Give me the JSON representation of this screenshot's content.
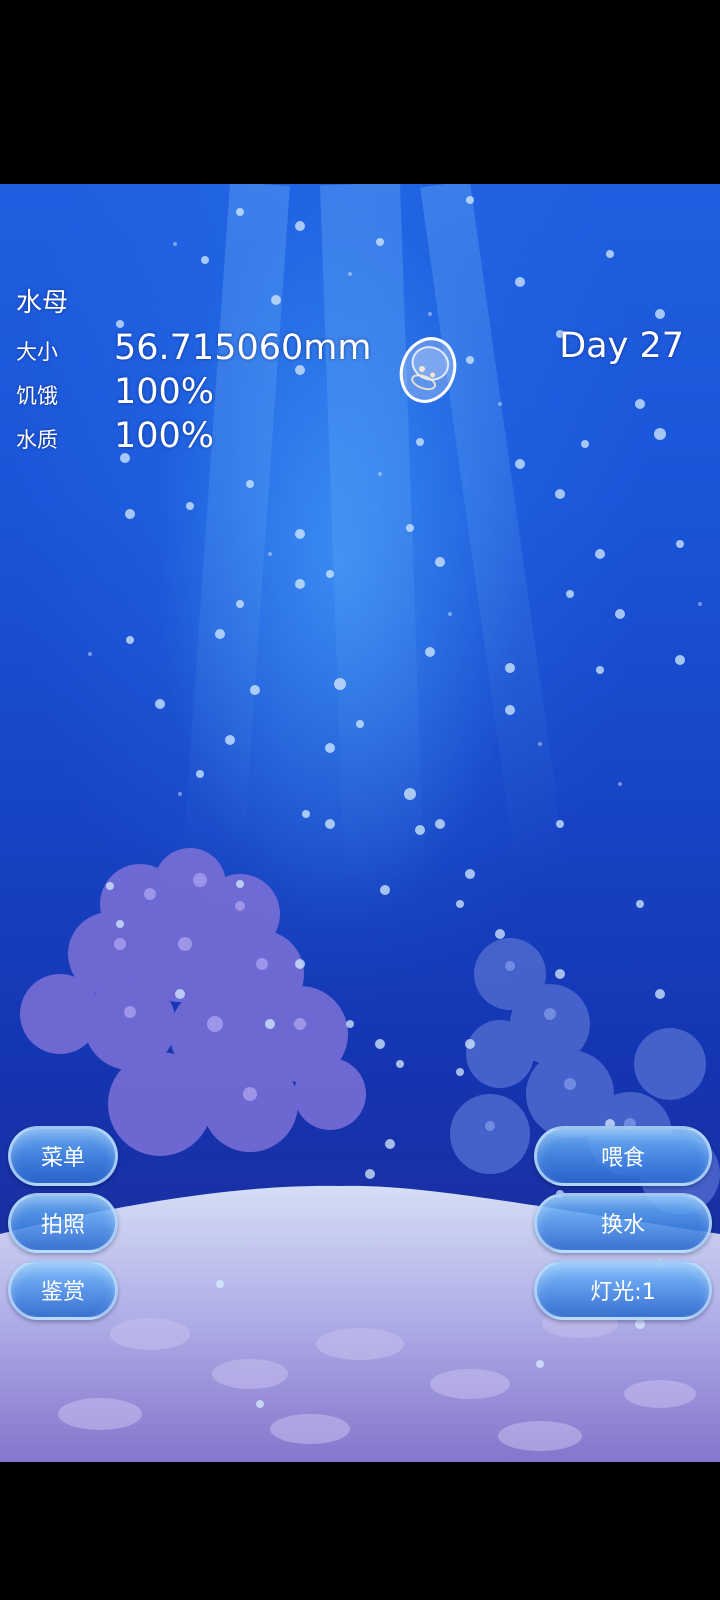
{
  "hud": {
    "title": "水母",
    "size_label": "大小",
    "size_value": "56.715060mm",
    "hunger_label": "饥饿",
    "hunger_value": "100%",
    "water_label": "水质",
    "water_value": "100%",
    "day": "Day 27"
  },
  "buttons_left": {
    "menu": "菜单",
    "photo": "拍照",
    "appreciate": "鉴赏"
  },
  "buttons_right": {
    "feed": "喂食",
    "change_water": "换水",
    "light": "灯光:1"
  },
  "colors": {
    "water_top": "#1f5fe0",
    "water_bottom": "#2a2f8e",
    "coral": "#8a7ee0",
    "sand": "#c8c8f0",
    "button": "#5a9ae8"
  }
}
